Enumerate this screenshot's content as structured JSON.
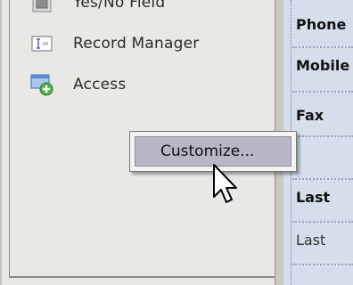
{
  "field_list": {
    "items": [
      {
        "label": "Yes/No Field",
        "icon": "checkbox-field-icon"
      },
      {
        "label": "Record Manager",
        "icon": "record-manager-icon"
      },
      {
        "label": "Access",
        "icon": "access-add-icon"
      }
    ]
  },
  "form": {
    "fields": [
      {
        "label": "Phone"
      },
      {
        "label": "Mobile"
      },
      {
        "label": "Fax"
      },
      {
        "label": "Last"
      },
      {
        "label": "Last"
      }
    ]
  },
  "context_menu": {
    "items": [
      {
        "label": "Customize..."
      }
    ]
  },
  "colors": {
    "panel_bg": "#e9e8e4",
    "form_bg": "#d6deeb",
    "menu_highlight": "#b8b7c6"
  }
}
